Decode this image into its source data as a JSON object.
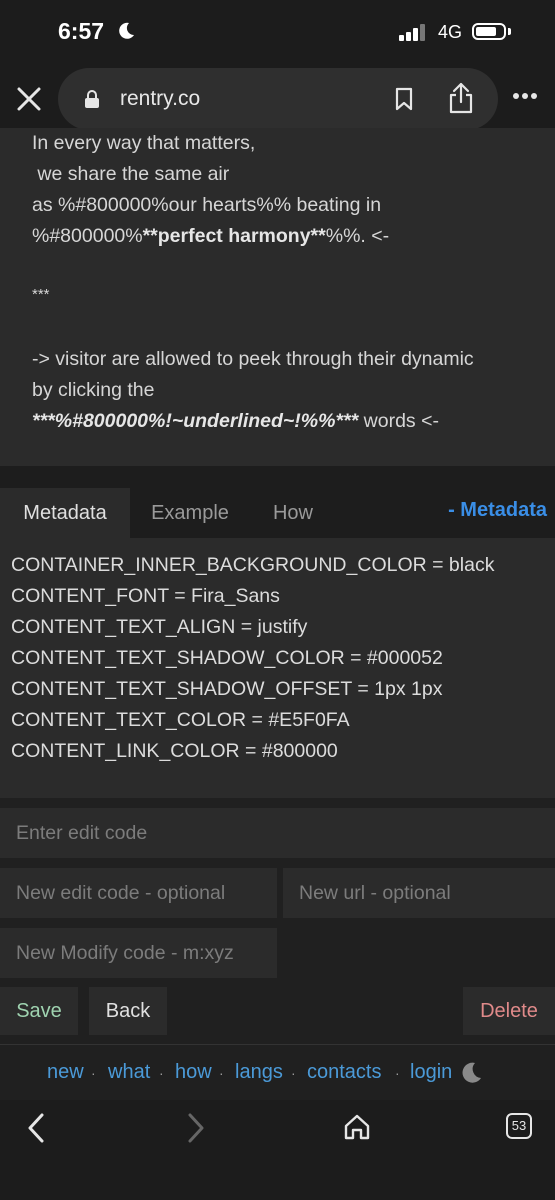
{
  "status": {
    "time": "6:57",
    "network": "4G"
  },
  "browser": {
    "url": "rentry.co",
    "tab_count": "53"
  },
  "content": {
    "line1": "In every way that matters,",
    "line2": " we share the same air",
    "line3": "as %#800000%our hearts%% beating in",
    "line4_pre": "%#800000%",
    "line4_bold": "**perfect harmony**",
    "line4_post": "%%. <-",
    "separator": "***",
    "line5": "-> visitor are allowed to peek through their dynamic",
    "line6": "by clicking the",
    "line7_bold": "***%#800000%!~underlined~!%%***",
    "line7_post": " words <-"
  },
  "tabs": {
    "metadata": "Metadata",
    "example": "Example",
    "how": "How",
    "metadata_link": "- Metadata"
  },
  "metadata": [
    "CONTAINER_INNER_BACKGROUND_COLOR = black",
    "CONTENT_FONT = Fira_Sans",
    "CONTENT_TEXT_ALIGN = justify",
    "CONTENT_TEXT_SHADOW_COLOR = #000052",
    "CONTENT_TEXT_SHADOW_OFFSET = 1px 1px",
    "CONTENT_TEXT_COLOR = #E5F0FA",
    "CONTENT_LINK_COLOR = #800000"
  ],
  "form": {
    "edit_code_placeholder": "Enter edit code",
    "new_edit_code_placeholder": "New edit code - optional",
    "new_url_placeholder": "New url - optional",
    "new_modify_code_placeholder": "New Modify code - m:xyz",
    "save": "Save",
    "back": "Back",
    "delete": "Delete"
  },
  "footer": {
    "links": [
      "new",
      "what",
      "how",
      "langs",
      "contacts",
      "login"
    ]
  },
  "colors": {
    "save_text": "#9fd3b0",
    "delete_text": "#e08a8a",
    "link": "#4b9ad8",
    "accent": "#3a8ee6"
  }
}
